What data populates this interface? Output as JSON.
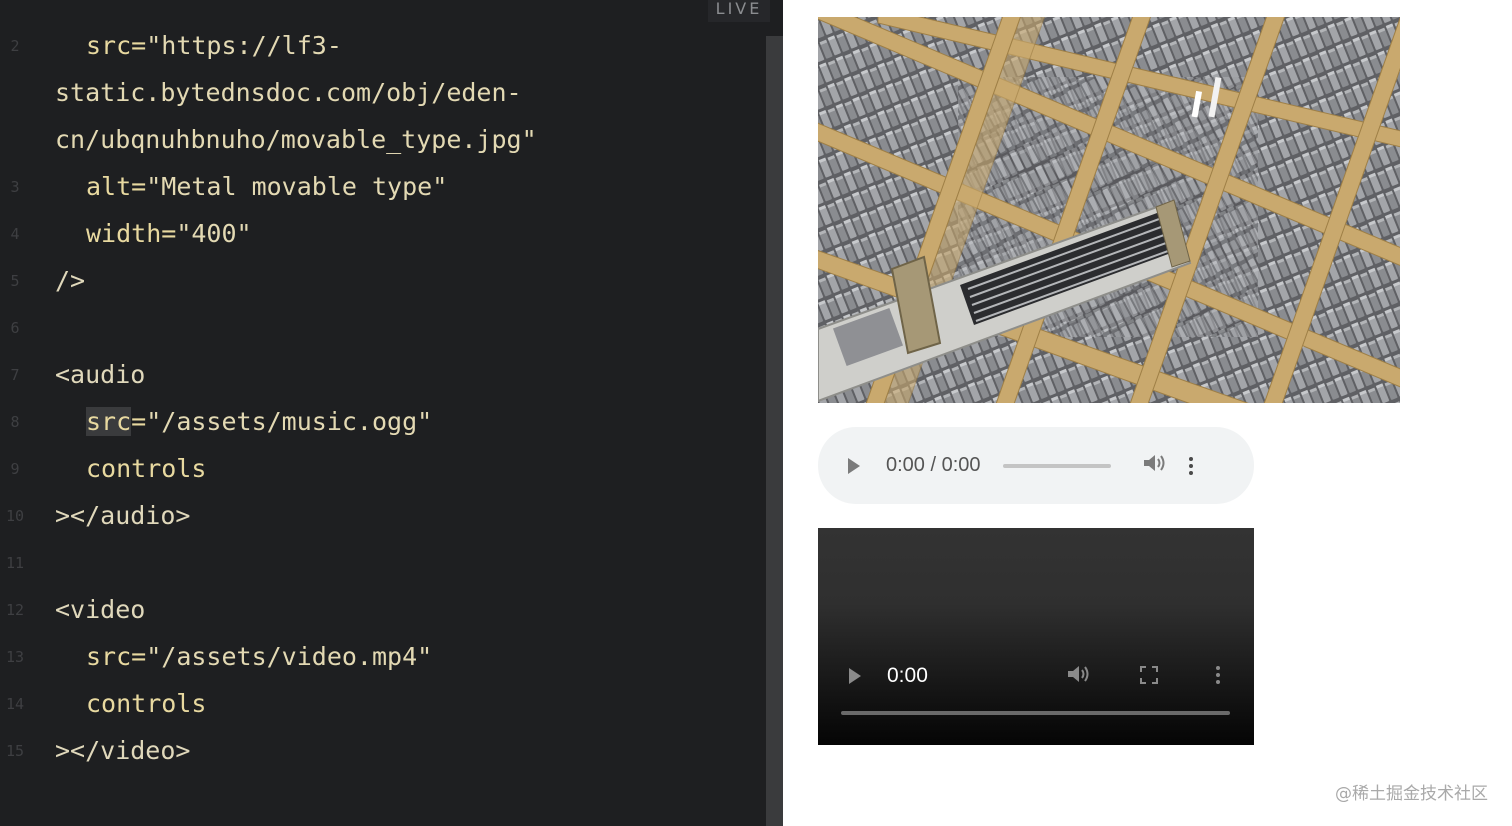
{
  "editor": {
    "live_label": "LIVE",
    "lines": [
      {
        "num": "2",
        "indent": true,
        "parts": [
          {
            "t": "src=",
            "c": "attr"
          },
          {
            "t": "\"https://lf3-",
            "c": "str"
          }
        ]
      },
      {
        "num": "",
        "indent": false,
        "parts": [
          {
            "t": "static.bytednsdoc.com/obj/eden-",
            "c": "str"
          }
        ]
      },
      {
        "num": "",
        "indent": false,
        "parts": [
          {
            "t": "cn/ubqnuhbnuho/movable_type.jpg\"",
            "c": "str"
          }
        ]
      },
      {
        "num": "3",
        "indent": true,
        "parts": [
          {
            "t": "alt=",
            "c": "attr"
          },
          {
            "t": "\"Metal movable type\"",
            "c": "str"
          }
        ]
      },
      {
        "num": "4",
        "indent": true,
        "parts": [
          {
            "t": "width=",
            "c": "attr"
          },
          {
            "t": "\"400\"",
            "c": "str"
          }
        ]
      },
      {
        "num": "5",
        "indent": false,
        "parts": [
          {
            "t": "/>",
            "c": "tag"
          }
        ]
      },
      {
        "num": "6",
        "indent": false,
        "parts": []
      },
      {
        "num": "7",
        "indent": false,
        "parts": [
          {
            "t": "<audio",
            "c": "tag"
          }
        ]
      },
      {
        "num": "8",
        "indent": true,
        "parts": [
          {
            "t": "src",
            "c": "attr",
            "hl": true
          },
          {
            "t": "=",
            "c": "attr"
          },
          {
            "t": "\"/assets/music.ogg\"",
            "c": "str"
          }
        ]
      },
      {
        "num": "9",
        "indent": true,
        "parts": [
          {
            "t": "controls",
            "c": "attr"
          }
        ]
      },
      {
        "num": "10",
        "indent": false,
        "parts": [
          {
            "t": "></audio>",
            "c": "tag"
          }
        ]
      },
      {
        "num": "11",
        "indent": false,
        "parts": []
      },
      {
        "num": "12",
        "indent": false,
        "parts": [
          {
            "t": "<video",
            "c": "tag"
          }
        ]
      },
      {
        "num": "13",
        "indent": true,
        "parts": [
          {
            "t": "src=",
            "c": "attr"
          },
          {
            "t": "\"/assets/video.mp4\"",
            "c": "str"
          }
        ]
      },
      {
        "num": "14",
        "indent": true,
        "parts": [
          {
            "t": "controls",
            "c": "attr"
          }
        ]
      },
      {
        "num": "15",
        "indent": false,
        "parts": [
          {
            "t": "></video>",
            "c": "tag"
          }
        ]
      }
    ]
  },
  "preview": {
    "image_alt": "Metal movable type",
    "audio": {
      "time": "0:00 / 0:00",
      "play_icon": "play-icon",
      "volume_icon": "volume-icon",
      "menu_icon": "more-vert-icon"
    },
    "video": {
      "time": "0:00",
      "play_icon": "play-icon",
      "volume_icon": "volume-icon",
      "fullscreen_icon": "fullscreen-icon",
      "menu_icon": "more-vert-icon"
    }
  },
  "watermark": "@稀土掘金技术社区"
}
